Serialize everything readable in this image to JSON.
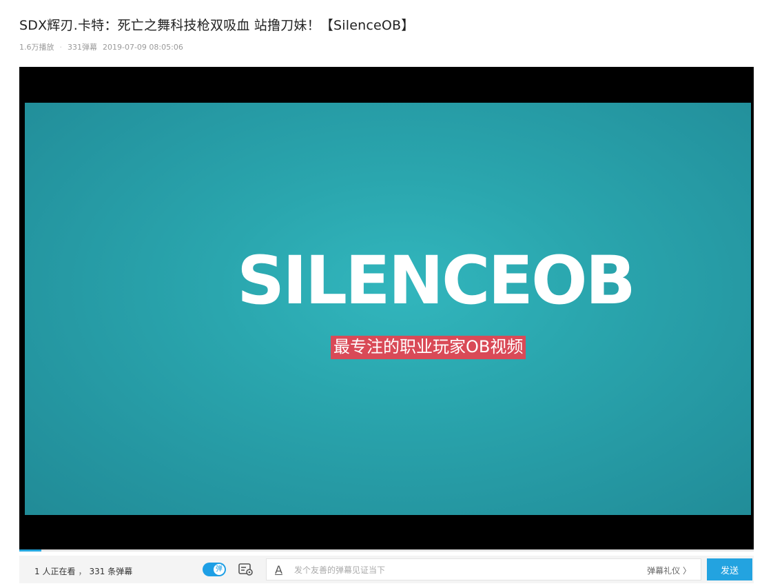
{
  "video": {
    "title": "SDX辉刃.卡特：死亡之舞科技枪双吸血 站撸刀妹！【SilenceOB】",
    "plays": "1.6万播放",
    "danmaku": "331弹幕",
    "date": "2019-07-09 08:05:06"
  },
  "frame": {
    "logo": "SILENCEOB",
    "tagline": "最专注的职业玩家OB视频",
    "progress": 0.03
  },
  "toolbar": {
    "viewers": "1 人正在看",
    "danmaku_count": "331 条弹幕",
    "toggle_glyph": "弹",
    "input_placeholder": "发个友善的弹幕见证当下",
    "etiquette": "弹幕礼仪 〉",
    "send_label": "发送"
  },
  "colors": {
    "accent": "#23a3e0",
    "video_bg": "#2aa6ae",
    "tagline_bg": "#d94a57"
  }
}
